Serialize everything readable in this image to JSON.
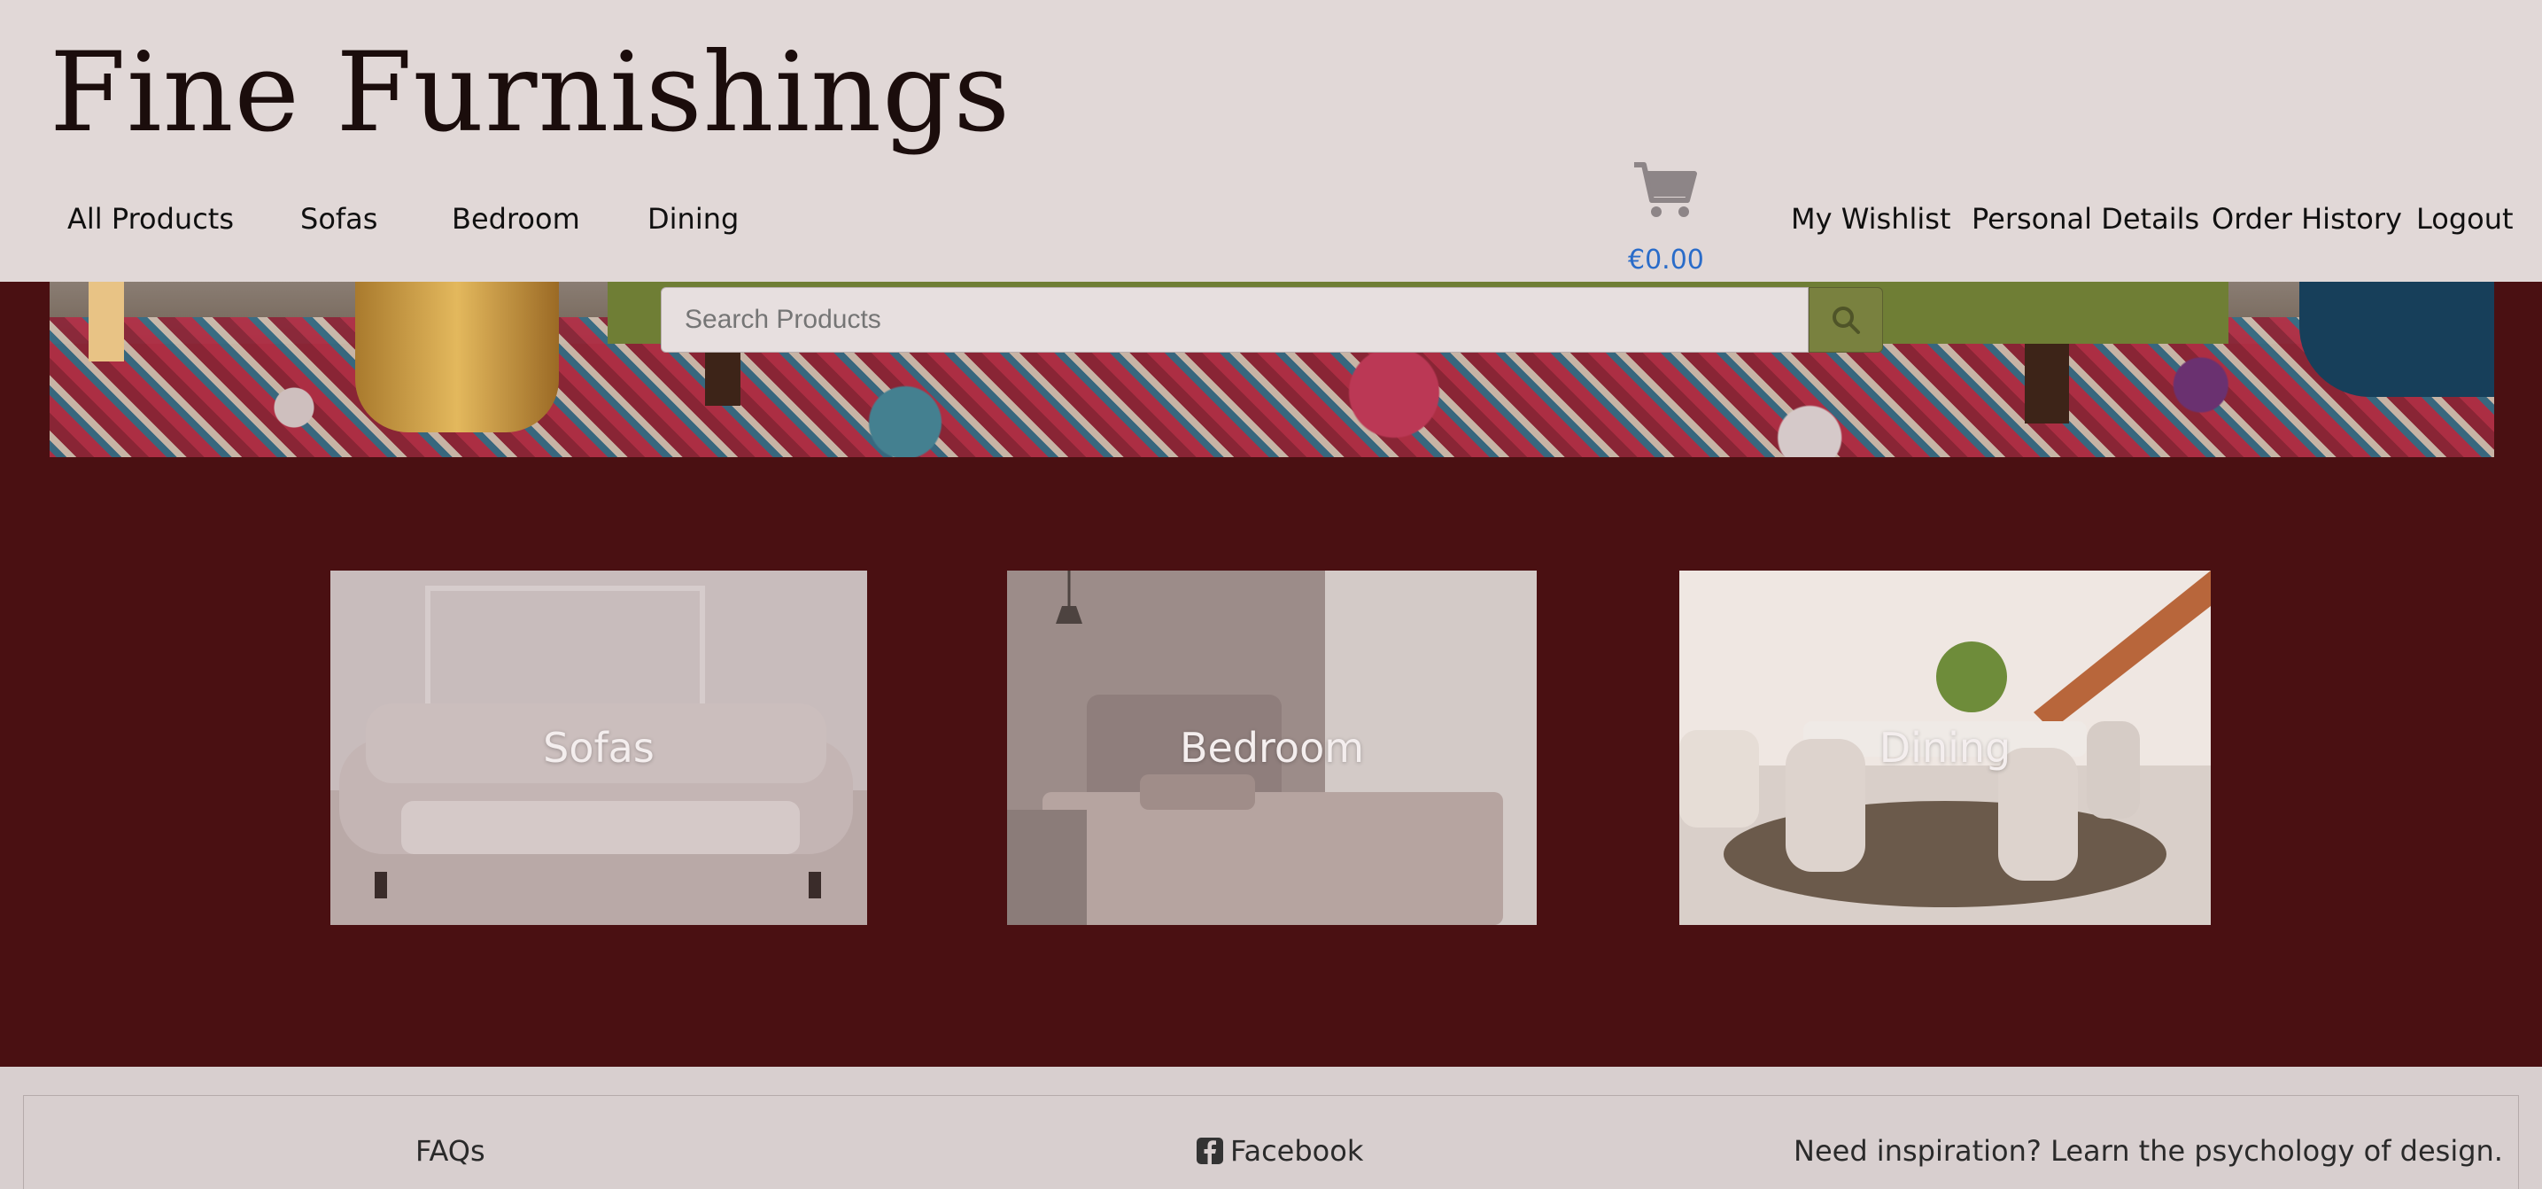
{
  "brand": "Fine Furnishings",
  "nav": {
    "left": [
      "All Products",
      "Sofas",
      "Bedroom",
      "Dining"
    ],
    "right": [
      "My Wishlist",
      "Personal Details",
      "Order History",
      "Logout"
    ]
  },
  "cart": {
    "icon": "shopping-cart-icon",
    "total": "€0.00"
  },
  "search": {
    "placeholder": "Search Products",
    "icon": "search-icon"
  },
  "categories": [
    {
      "label": "Sofas"
    },
    {
      "label": "Bedroom"
    },
    {
      "label": "Dining"
    }
  ],
  "footer": {
    "faqs": "FAQs",
    "facebook": "Facebook",
    "facebook_icon": "facebook-square-icon",
    "inspiration": "Need inspiration? Learn the psychology of design."
  },
  "colors": {
    "header_bg": "#e1d8d7",
    "page_bg": "#4a1012",
    "cart_total": "#2a6cc9",
    "search_button": "#79813f"
  }
}
